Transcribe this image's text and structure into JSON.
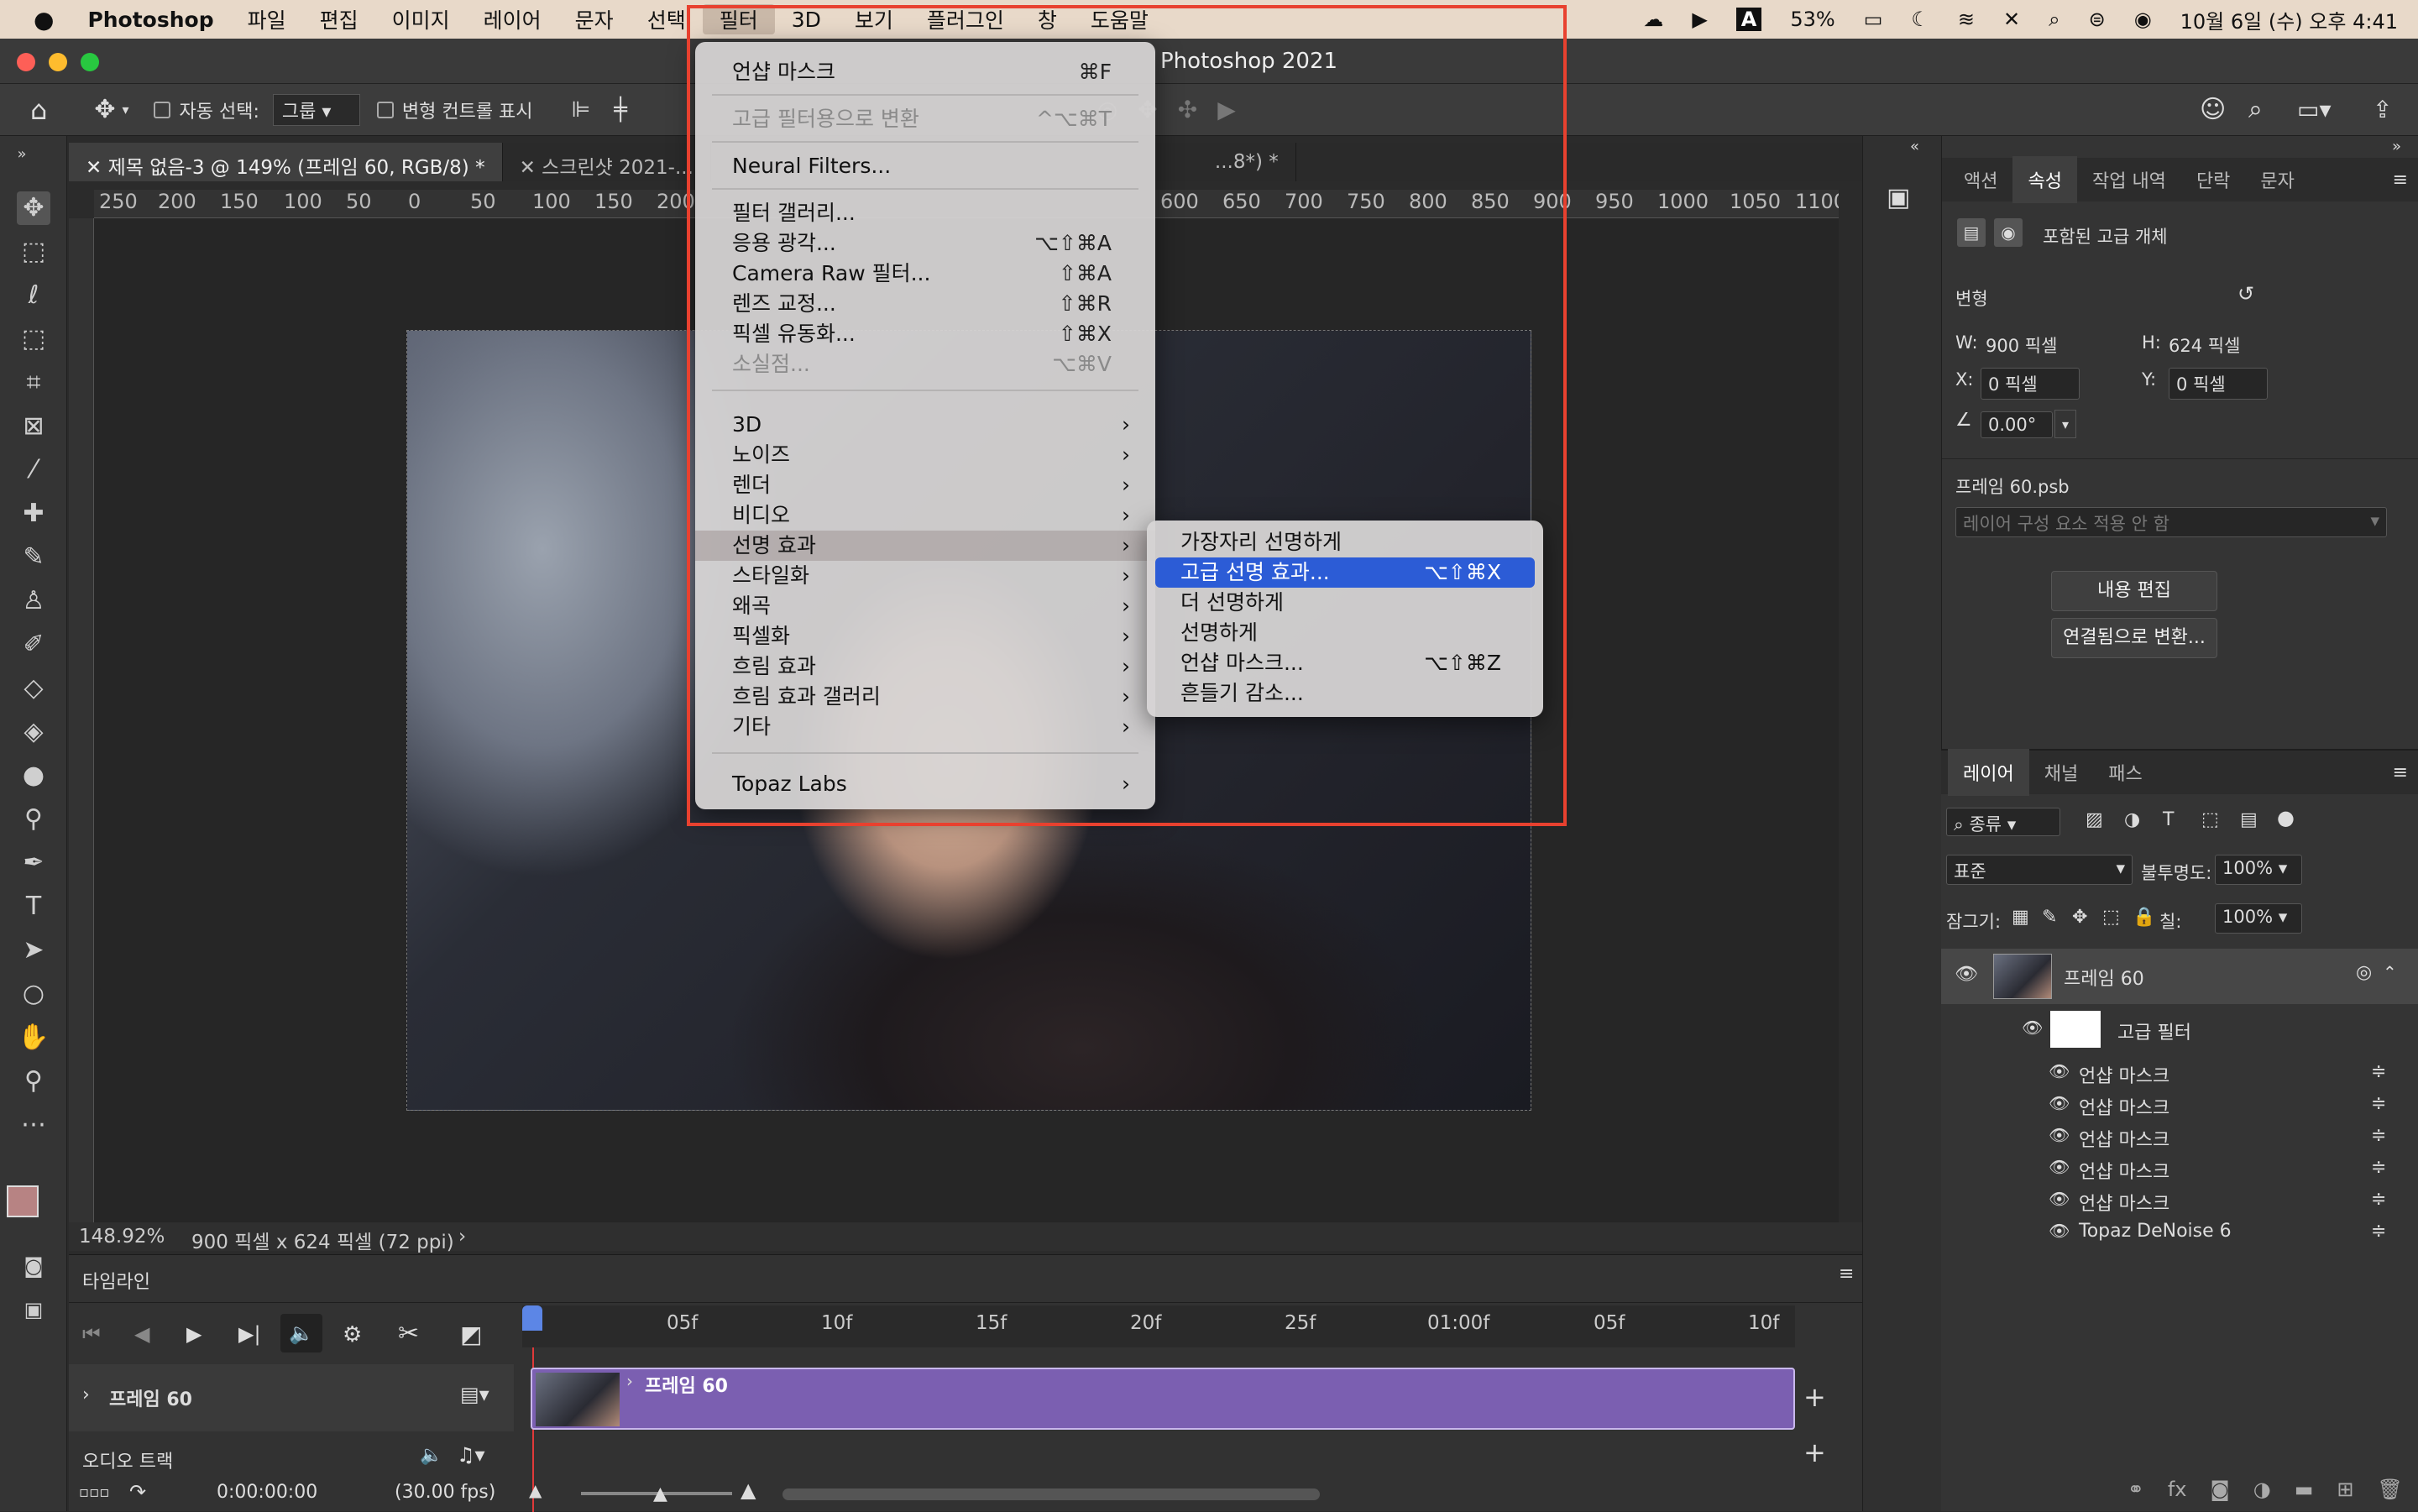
{
  "menubar": {
    "apple": "",
    "app": "Photoshop",
    "items": [
      "파일",
      "편집",
      "이미지",
      "레이어",
      "문자",
      "선택",
      "필터",
      "3D",
      "보기",
      "플러그인",
      "창",
      "도움말"
    ],
    "selected": "필터",
    "battery": "53%",
    "datetime": "10월 6일 (수) 오후 4:41"
  },
  "window": {
    "title": "Photoshop 2021"
  },
  "options": {
    "auto_select_label": "자동 선택:",
    "auto_select_value": "그룹",
    "transform_label": "변형 컨트롤 표시"
  },
  "tabs": [
    {
      "label": "제목 없음-3 @ 149% (프레임 60, RGB/8) *"
    },
    {
      "label": "스크린샷 2021-..."
    },
    {
      "label": "...8*) *"
    }
  ],
  "ruler": {
    "h": [
      "250",
      "200",
      "150",
      "100",
      "50",
      "0",
      "50",
      "100",
      "150",
      "200",
      "600",
      "650",
      "700",
      "750",
      "800",
      "850",
      "900",
      "950",
      "1000",
      "1050",
      "1100"
    ]
  },
  "status": {
    "zoom": "148.92%",
    "doc": "900 픽셀 x 624 픽셀 (72 ppi)"
  },
  "filter_menu": {
    "items": [
      {
        "label": "언샵 마스크",
        "shortcut": "⌘F"
      },
      {
        "label": "고급 필터용으로 변환",
        "shortcut": "^⌥⌘T",
        "disabled": true
      },
      {
        "label": "Neural Filters..."
      },
      {
        "label": "필터 갤러리..."
      },
      {
        "label": "응용 광각...",
        "shortcut": "⌥⇧⌘A"
      },
      {
        "label": "Camera Raw 필터...",
        "shortcut": "⇧⌘A"
      },
      {
        "label": "렌즈 교정...",
        "shortcut": "⇧⌘R"
      },
      {
        "label": "픽셀 유동화...",
        "shortcut": "⇧⌘X"
      },
      {
        "label": "소실점...",
        "shortcut": "⌥⌘V",
        "disabled": true
      },
      {
        "label": "3D"
      },
      {
        "label": "노이즈"
      },
      {
        "label": "렌더"
      },
      {
        "label": "비디오"
      },
      {
        "label": "선명 효과"
      },
      {
        "label": "스타일화"
      },
      {
        "label": "왜곡"
      },
      {
        "label": "픽셀화"
      },
      {
        "label": "흐림 효과"
      },
      {
        "label": "흐림 효과 갤러리"
      },
      {
        "label": "기타"
      },
      {
        "label": "Topaz Labs"
      }
    ]
  },
  "sharpen_submenu": {
    "items": [
      {
        "label": "가장자리 선명하게"
      },
      {
        "label": "고급 선명 효과...",
        "shortcut": "⌥⇧⌘X"
      },
      {
        "label": "더 선명하게"
      },
      {
        "label": "선명하게"
      },
      {
        "label": "언샵 마스크...",
        "shortcut": "⌥⇧⌘Z"
      },
      {
        "label": "흔들기 감소..."
      }
    ]
  },
  "properties": {
    "tabs": [
      "액션",
      "속성",
      "작업 내역",
      "단락",
      "문자"
    ],
    "active_tab": "속성",
    "object_type": "포함된 고급 개체",
    "section": "변형",
    "w_label": "W:",
    "w": "900 픽셀",
    "h_label": "H:",
    "h": "624 픽셀",
    "x_label": "X:",
    "x": "0 픽셀",
    "y_label": "Y:",
    "y": "0 픽셀",
    "angle": "0.00°",
    "file": "프레임 60.psb",
    "comp_placeholder": "레이어 구성 요소 적용 안 함",
    "edit_button": "내용 편집",
    "convert_button": "연결됨으로 변환..."
  },
  "layers": {
    "tabs": [
      "레이어",
      "채널",
      "패스"
    ],
    "active_tab": "레이어",
    "kind": "종류",
    "blend": "표준",
    "opacity_label": "불투명도:",
    "opacity": "100%",
    "lock_label": "잠그기:",
    "fill_label": "칠:",
    "fill": "100%",
    "layer_name": "프레임 60",
    "smart_filter": "고급 필터",
    "filters": [
      "언샵 마스크",
      "언샵 마스크",
      "언샵 마스크",
      "언샵 마스크",
      "언샵 마스크",
      "Topaz DeNoise 6"
    ]
  },
  "timeline": {
    "title": "타임라인",
    "ticks": [
      "05f",
      "10f",
      "15f",
      "20f",
      "25f",
      "01:00f",
      "05f",
      "10f"
    ],
    "track_label": "프레임 60",
    "clip_label": "프레임 60",
    "audio_label": "오디오 트랙",
    "timecode": "0:00:00:00",
    "fps": "(30.00 fps)"
  },
  "colors": {
    "highlight": "#2c5cd6",
    "clip": "#7b5fb1",
    "annotation": "#e8412f"
  }
}
